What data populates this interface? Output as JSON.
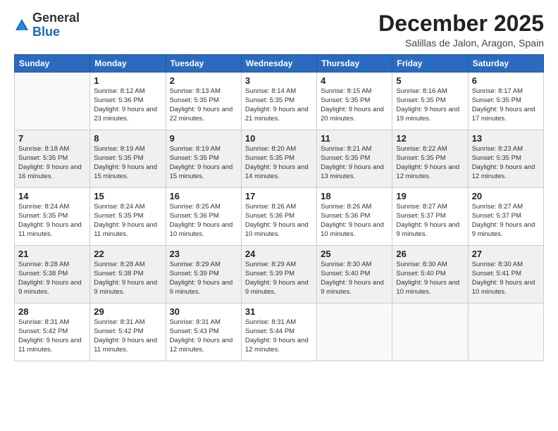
{
  "logo": {
    "general": "General",
    "blue": "Blue"
  },
  "header": {
    "month": "December 2025",
    "location": "Salillas de Jalon, Aragon, Spain"
  },
  "days_of_week": [
    "Sunday",
    "Monday",
    "Tuesday",
    "Wednesday",
    "Thursday",
    "Friday",
    "Saturday"
  ],
  "weeks": [
    [
      {
        "day": "",
        "sunrise": "",
        "sunset": "",
        "daylight": ""
      },
      {
        "day": "1",
        "sunrise": "Sunrise: 8:12 AM",
        "sunset": "Sunset: 5:36 PM",
        "daylight": "Daylight: 9 hours and 23 minutes."
      },
      {
        "day": "2",
        "sunrise": "Sunrise: 8:13 AM",
        "sunset": "Sunset: 5:35 PM",
        "daylight": "Daylight: 9 hours and 22 minutes."
      },
      {
        "day": "3",
        "sunrise": "Sunrise: 8:14 AM",
        "sunset": "Sunset: 5:35 PM",
        "daylight": "Daylight: 9 hours and 21 minutes."
      },
      {
        "day": "4",
        "sunrise": "Sunrise: 8:15 AM",
        "sunset": "Sunset: 5:35 PM",
        "daylight": "Daylight: 9 hours and 20 minutes."
      },
      {
        "day": "5",
        "sunrise": "Sunrise: 8:16 AM",
        "sunset": "Sunset: 5:35 PM",
        "daylight": "Daylight: 9 hours and 19 minutes."
      },
      {
        "day": "6",
        "sunrise": "Sunrise: 8:17 AM",
        "sunset": "Sunset: 5:35 PM",
        "daylight": "Daylight: 9 hours and 17 minutes."
      }
    ],
    [
      {
        "day": "7",
        "sunrise": "Sunrise: 8:18 AM",
        "sunset": "Sunset: 5:35 PM",
        "daylight": "Daylight: 9 hours and 16 minutes."
      },
      {
        "day": "8",
        "sunrise": "Sunrise: 8:19 AM",
        "sunset": "Sunset: 5:35 PM",
        "daylight": "Daylight: 9 hours and 15 minutes."
      },
      {
        "day": "9",
        "sunrise": "Sunrise: 8:19 AM",
        "sunset": "Sunset: 5:35 PM",
        "daylight": "Daylight: 9 hours and 15 minutes."
      },
      {
        "day": "10",
        "sunrise": "Sunrise: 8:20 AM",
        "sunset": "Sunset: 5:35 PM",
        "daylight": "Daylight: 9 hours and 14 minutes."
      },
      {
        "day": "11",
        "sunrise": "Sunrise: 8:21 AM",
        "sunset": "Sunset: 5:35 PM",
        "daylight": "Daylight: 9 hours and 13 minutes."
      },
      {
        "day": "12",
        "sunrise": "Sunrise: 8:22 AM",
        "sunset": "Sunset: 5:35 PM",
        "daylight": "Daylight: 9 hours and 12 minutes."
      },
      {
        "day": "13",
        "sunrise": "Sunrise: 8:23 AM",
        "sunset": "Sunset: 5:35 PM",
        "daylight": "Daylight: 9 hours and 12 minutes."
      }
    ],
    [
      {
        "day": "14",
        "sunrise": "Sunrise: 8:24 AM",
        "sunset": "Sunset: 5:35 PM",
        "daylight": "Daylight: 9 hours and 11 minutes."
      },
      {
        "day": "15",
        "sunrise": "Sunrise: 8:24 AM",
        "sunset": "Sunset: 5:35 PM",
        "daylight": "Daylight: 9 hours and 11 minutes."
      },
      {
        "day": "16",
        "sunrise": "Sunrise: 8:25 AM",
        "sunset": "Sunset: 5:36 PM",
        "daylight": "Daylight: 9 hours and 10 minutes."
      },
      {
        "day": "17",
        "sunrise": "Sunrise: 8:26 AM",
        "sunset": "Sunset: 5:36 PM",
        "daylight": "Daylight: 9 hours and 10 minutes."
      },
      {
        "day": "18",
        "sunrise": "Sunrise: 8:26 AM",
        "sunset": "Sunset: 5:36 PM",
        "daylight": "Daylight: 9 hours and 10 minutes."
      },
      {
        "day": "19",
        "sunrise": "Sunrise: 8:27 AM",
        "sunset": "Sunset: 5:37 PM",
        "daylight": "Daylight: 9 hours and 9 minutes."
      },
      {
        "day": "20",
        "sunrise": "Sunrise: 8:27 AM",
        "sunset": "Sunset: 5:37 PM",
        "daylight": "Daylight: 9 hours and 9 minutes."
      }
    ],
    [
      {
        "day": "21",
        "sunrise": "Sunrise: 8:28 AM",
        "sunset": "Sunset: 5:38 PM",
        "daylight": "Daylight: 9 hours and 9 minutes."
      },
      {
        "day": "22",
        "sunrise": "Sunrise: 8:28 AM",
        "sunset": "Sunset: 5:38 PM",
        "daylight": "Daylight: 9 hours and 9 minutes."
      },
      {
        "day": "23",
        "sunrise": "Sunrise: 8:29 AM",
        "sunset": "Sunset: 5:39 PM",
        "daylight": "Daylight: 9 hours and 9 minutes."
      },
      {
        "day": "24",
        "sunrise": "Sunrise: 8:29 AM",
        "sunset": "Sunset: 5:39 PM",
        "daylight": "Daylight: 9 hours and 9 minutes."
      },
      {
        "day": "25",
        "sunrise": "Sunrise: 8:30 AM",
        "sunset": "Sunset: 5:40 PM",
        "daylight": "Daylight: 9 hours and 9 minutes."
      },
      {
        "day": "26",
        "sunrise": "Sunrise: 8:30 AM",
        "sunset": "Sunset: 5:40 PM",
        "daylight": "Daylight: 9 hours and 10 minutes."
      },
      {
        "day": "27",
        "sunrise": "Sunrise: 8:30 AM",
        "sunset": "Sunset: 5:41 PM",
        "daylight": "Daylight: 9 hours and 10 minutes."
      }
    ],
    [
      {
        "day": "28",
        "sunrise": "Sunrise: 8:31 AM",
        "sunset": "Sunset: 5:42 PM",
        "daylight": "Daylight: 9 hours and 11 minutes."
      },
      {
        "day": "29",
        "sunrise": "Sunrise: 8:31 AM",
        "sunset": "Sunset: 5:42 PM",
        "daylight": "Daylight: 9 hours and 11 minutes."
      },
      {
        "day": "30",
        "sunrise": "Sunrise: 8:31 AM",
        "sunset": "Sunset: 5:43 PM",
        "daylight": "Daylight: 9 hours and 12 minutes."
      },
      {
        "day": "31",
        "sunrise": "Sunrise: 8:31 AM",
        "sunset": "Sunset: 5:44 PM",
        "daylight": "Daylight: 9 hours and 12 minutes."
      },
      {
        "day": "",
        "sunrise": "",
        "sunset": "",
        "daylight": ""
      },
      {
        "day": "",
        "sunrise": "",
        "sunset": "",
        "daylight": ""
      },
      {
        "day": "",
        "sunrise": "",
        "sunset": "",
        "daylight": ""
      }
    ]
  ]
}
